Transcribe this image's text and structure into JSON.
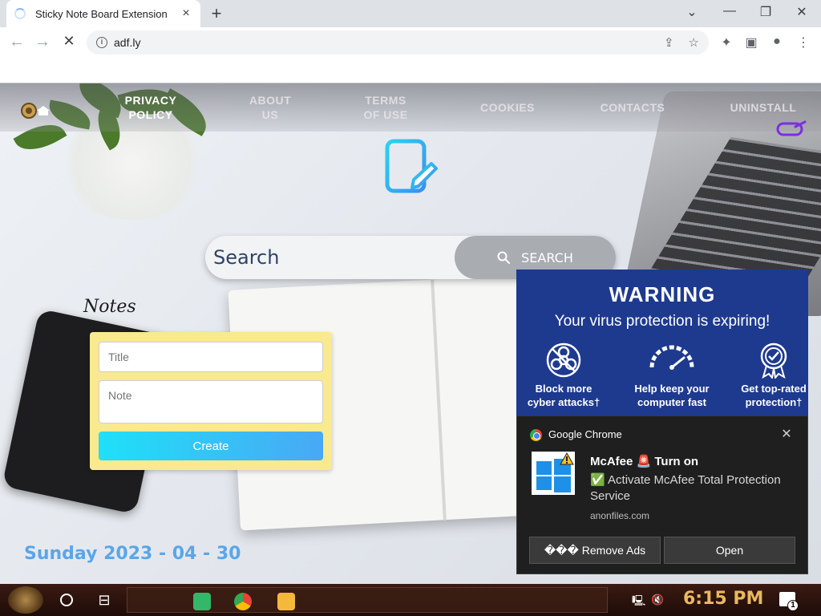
{
  "browser": {
    "tab_title": "Sticky Note Board Extension",
    "tab_close": "×",
    "new_tab": "+",
    "win_minimize": "—",
    "win_restore": "❐",
    "win_close": "✕",
    "win_menu": "⌄",
    "url": "adf.ly",
    "back": "←",
    "forward": "→",
    "reload": "✕",
    "share_icon": "⇪",
    "star_icon": "☆",
    "extensions_icon": "✦",
    "sidepanel_icon": "▣",
    "profile_icon": "●",
    "menu_icon": "⋮"
  },
  "site": {
    "nav": {
      "privacy_line1": "PRIVACY",
      "privacy_line2": "POLICY",
      "about_line1": "ABOUT",
      "about_line2": "US",
      "terms_line1": "TERMS",
      "terms_line2": "OF USE",
      "cookies": "COOKIES",
      "contacts": "CONTACTS",
      "uninstall": "UNINSTALL"
    },
    "search": {
      "placeholder": "Search",
      "button_label": "SEARCH"
    },
    "notes": {
      "heading": "Notes",
      "title_placeholder": "Title",
      "note_placeholder": "Note",
      "create_label": "Create"
    },
    "date": "Sunday 2023 - 04 - 30",
    "colors": {
      "note_card": "#f9e98f",
      "create_gradient_start": "#1fe0f8",
      "create_gradient_end": "#49a8f4",
      "date_text": "#5aa6e8"
    }
  },
  "warning_ad": {
    "title": "WARNING",
    "subtitle": "Your virus protection is expiring!",
    "features": [
      {
        "icon": "biohazard-icon",
        "line1": "Block more",
        "line2": "cyber attacks†"
      },
      {
        "icon": "speedometer-icon",
        "line1": "Help keep your",
        "line2": "computer fast"
      },
      {
        "icon": "award-badge-icon",
        "line1": "Get top-rated",
        "line2": "protection†"
      }
    ],
    "background": "#1e3a8f"
  },
  "notification": {
    "app_name": "Google Chrome",
    "close": "✕",
    "title": "McAfee 🚨 Turn on",
    "message": "✅ Activate McAfee Total Protection Service",
    "source": "anonfiles.com",
    "button_remove": "��� Remove Ads",
    "button_open": "Open"
  },
  "taskbar": {
    "time": "6:15 PM",
    "taskview_icon": "⊟",
    "network_icon": "🖳",
    "volume_icon": "🔇",
    "notify_count": "1"
  }
}
